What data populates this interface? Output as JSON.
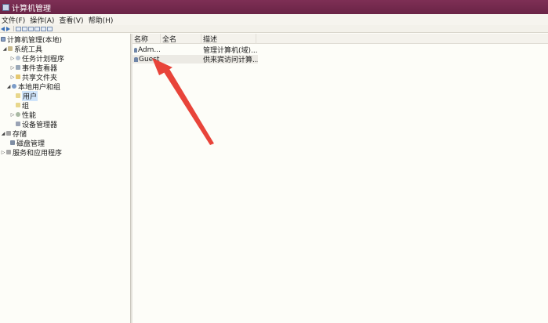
{
  "window": {
    "title": "计算机管理"
  },
  "menu": [
    "文件(F)",
    "操作(A)",
    "查看(V)",
    "帮助(H)"
  ],
  "tree": {
    "root": "计算机管理(本地)",
    "system_tools": "系统工具",
    "task_scheduler": "任务计划程序",
    "event_viewer": "事件查看器",
    "shared_folders": "共享文件夹",
    "local_users_groups": "本地用户和组",
    "users": "用户",
    "groups": "组",
    "performance": "性能",
    "device_manager": "设备管理器",
    "storage": "存储",
    "disk_management": "磁盘管理",
    "services_apps": "服务和应用程序"
  },
  "list": {
    "columns": {
      "name": "名称",
      "fullname": "全名",
      "description": "描述"
    },
    "rows": [
      {
        "name": "Adm...",
        "fullname": "",
        "description": "管理计算机(域)..."
      },
      {
        "name": "Guest",
        "fullname": "",
        "description": "供来宾访问计算..."
      }
    ]
  },
  "colors": {
    "titlebar": "#6f2a4c",
    "arrow": "#e8443a",
    "selection": "#cfe4fa"
  }
}
